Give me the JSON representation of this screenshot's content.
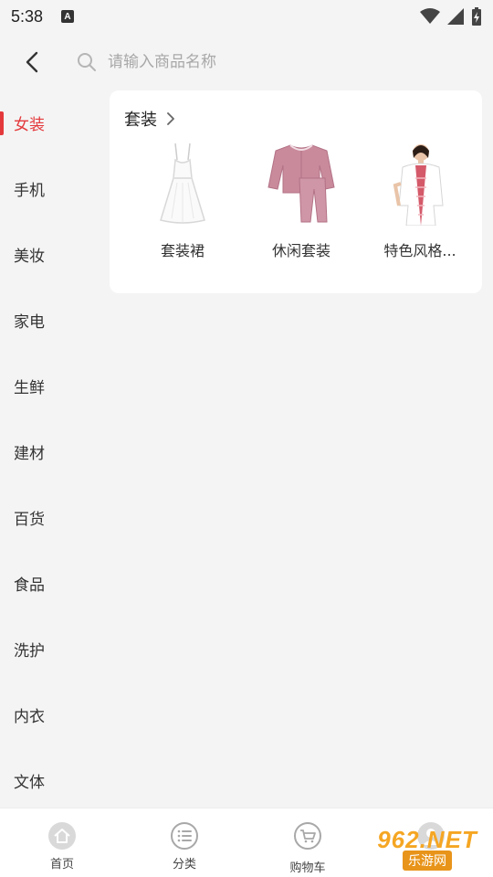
{
  "status": {
    "time": "5:38",
    "badge": "A"
  },
  "search": {
    "placeholder": "请输入商品名称"
  },
  "sidebar": {
    "items": [
      {
        "label": "女装",
        "active": true
      },
      {
        "label": "手机"
      },
      {
        "label": "美妆"
      },
      {
        "label": "家电"
      },
      {
        "label": "生鲜"
      },
      {
        "label": "建材"
      },
      {
        "label": "百货"
      },
      {
        "label": "食品"
      },
      {
        "label": "洗护"
      },
      {
        "label": "内衣"
      },
      {
        "label": "文体"
      }
    ]
  },
  "section": {
    "title": "套装",
    "products": [
      {
        "name": "套装裙",
        "icon": "white-dress-image"
      },
      {
        "name": "休闲套装",
        "icon": "pink-pajama-set-image"
      },
      {
        "name": "特色风格...",
        "icon": "woman-in-white-blazer-image"
      }
    ]
  },
  "tabbar": {
    "home": "首页",
    "category": "分类",
    "cart": "购物车"
  },
  "watermark": {
    "top": "962.NET",
    "bottom": "乐游网"
  },
  "colors": {
    "accent": "#e4393c",
    "background": "#f4f4f4"
  }
}
